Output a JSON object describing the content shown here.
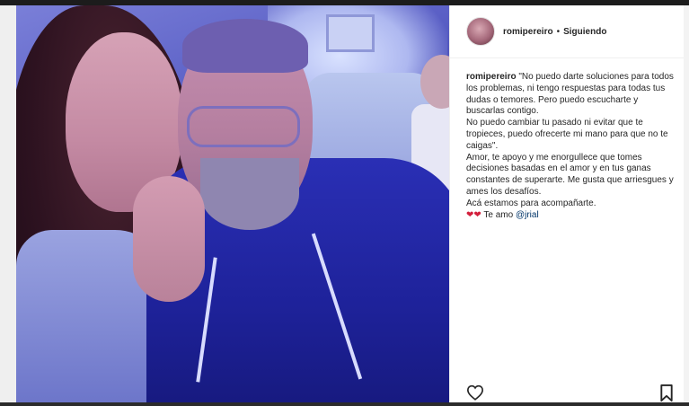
{
  "post": {
    "username": "romipereiro",
    "separator": "•",
    "follow_status": "Siguiendo",
    "caption": {
      "author": "romipereiro",
      "lines": [
        "\"No puedo darte soluciones para todos los problemas, ni tengo respuestas para todas tus dudas o temores. Pero puedo escucharte y buscarlas contigo.",
        "No puedo cambiar tu pasado ni evitar que te tropieces, puedo ofrecerte mi mano para que no te caigas\".",
        "Amor, te apoyo y me enorgullece que tomes decisiones basadas en el amor y en tus ganas constantes de superarte. Me gusta que arriesgues y ames los desafíos.",
        "Acá estamos para acompañarte."
      ],
      "signoff_hearts": "❤❤",
      "signoff_text": "Te amo",
      "mention": "@jrial"
    }
  },
  "icons": {
    "like": "heart-outline-icon",
    "save": "bookmark-icon"
  },
  "colors": {
    "text": "#262626",
    "mention": "#003569",
    "heart": "#d31f3c"
  }
}
